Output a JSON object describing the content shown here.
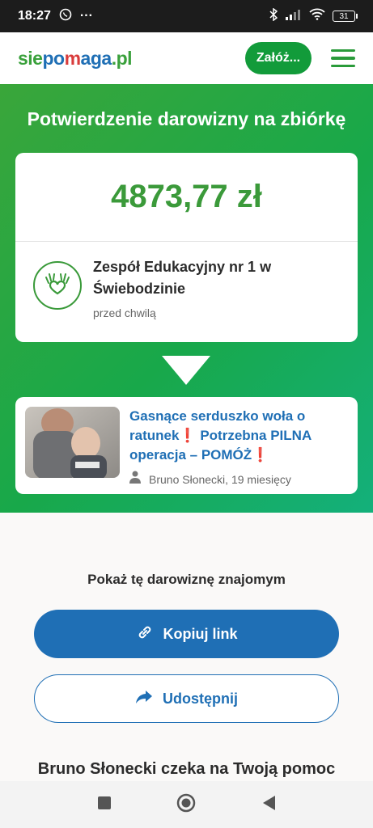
{
  "status_bar": {
    "time": "18:27",
    "dots": "···",
    "battery": "31"
  },
  "header": {
    "logo": {
      "part1": "sie",
      "part2": "po",
      "part3": "m",
      "part4": "aga",
      "part5": ".pl"
    },
    "cta_label": "Załóż...",
    "menu_icon": "hamburger-icon"
  },
  "hero": {
    "title": "Potwierdzenie darowizny na zbiórkę",
    "amount": "4873,77 zł",
    "org_name": "Zespół Edukacyjny nr 1 w Świebodzinie",
    "org_time": "przed chwilą"
  },
  "campaign": {
    "title_part1": "Gasnące serduszko woła o ratunek",
    "title_part2": " Potrzebna PILNA operacja – POMÓŻ",
    "meta": "Bruno Słonecki, 19 miesięcy"
  },
  "share": {
    "title": "Pokaż tę darowiznę znajomym",
    "copy_label": "Kopiuj link",
    "share_label": "Udostępnij"
  },
  "bottom": {
    "title": "Bruno Słonecki czeka na Twoją pomoc"
  },
  "colors": {
    "green": "#3aa13c",
    "blue": "#1f6fb5",
    "red": "#d93c3c"
  }
}
